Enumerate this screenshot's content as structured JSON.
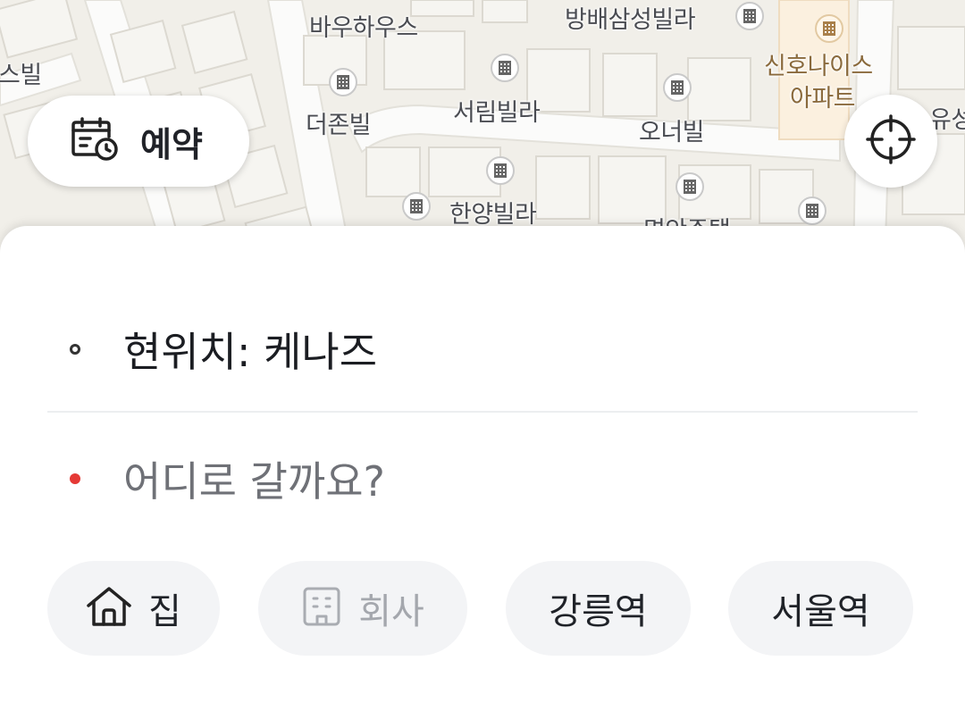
{
  "map": {
    "labels": {
      "bauhaus": "바우하우스",
      "bangbae_samsung": "방배삼성빌라",
      "sinho_nice": "신호나이스",
      "apartment": "아파트",
      "seubil": "스빌",
      "seorim": "서림빌라",
      "thezon": "더존빌",
      "owner": "오너빌",
      "yuseong": "유성",
      "hanyang": "한양빌라",
      "myeongan": "명안주택"
    }
  },
  "controls": {
    "reserve_label": "예약"
  },
  "route": {
    "origin": "현위치: 케나즈",
    "destination_placeholder": "어디로 갈까요?"
  },
  "shortcuts": [
    {
      "label": "집",
      "icon": "home-icon",
      "enabled": true
    },
    {
      "label": "회사",
      "icon": "building-icon",
      "enabled": false
    },
    {
      "label": "강릉역",
      "enabled": true
    },
    {
      "label": "서울역",
      "enabled": true
    }
  ],
  "colors": {
    "destination_dot": "#e53935",
    "chip_background": "#f3f4f6",
    "map_background": "#f1efe9",
    "apartment_label": "#8a6a3c"
  }
}
